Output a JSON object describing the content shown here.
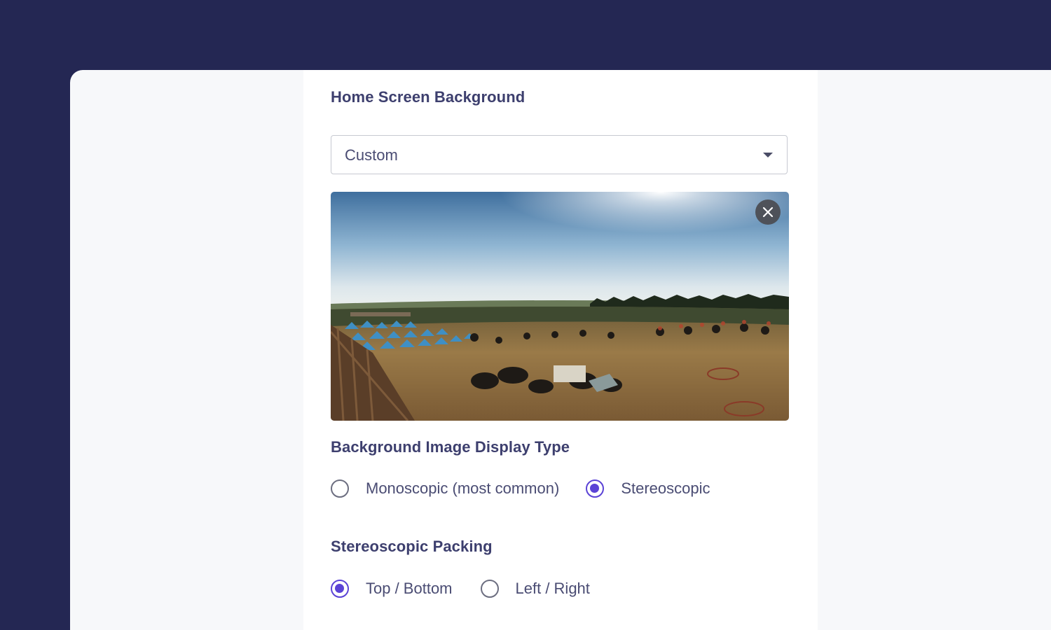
{
  "colors": {
    "frame_bg": "#242753",
    "shell_bg": "#f7f8fa",
    "panel_bg": "#ffffff",
    "heading": "#3d3f6e",
    "text": "#4a4c73",
    "accent": "#5b43d6",
    "radio_off": "#6c6e80"
  },
  "home_background": {
    "heading": "Home Screen Background",
    "select": {
      "value": "Custom",
      "icon": "chevron-down-icon"
    },
    "preview": {
      "close_icon": "close-icon"
    }
  },
  "display_type": {
    "heading": "Background Image Display Type",
    "options": [
      {
        "label": "Monoscopic (most common)",
        "selected": false
      },
      {
        "label": "Stereoscopic",
        "selected": true
      }
    ]
  },
  "packing": {
    "heading": "Stereoscopic Packing",
    "options": [
      {
        "label": "Top / Bottom",
        "selected": true
      },
      {
        "label": "Left / Right",
        "selected": false
      }
    ]
  }
}
